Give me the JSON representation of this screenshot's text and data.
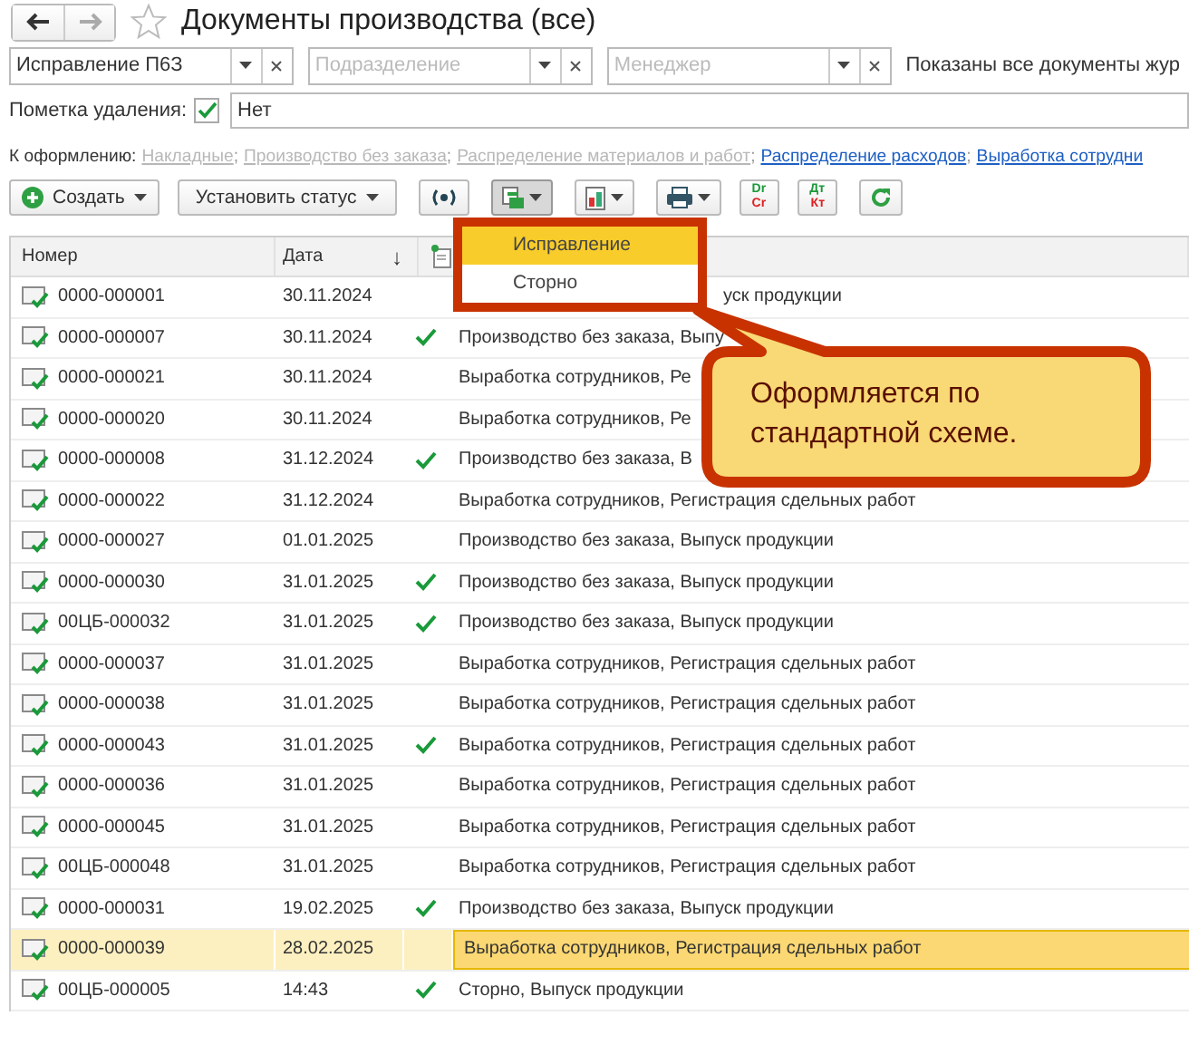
{
  "window": {
    "title": "Документы производства (все)",
    "favorite": false
  },
  "filters": [
    {
      "value": "Исправление П6З"
    },
    {
      "placeholder": "Подразделение"
    },
    {
      "placeholder": "Менеджер"
    }
  ],
  "filter_note": "Показаны все документы жур",
  "deletion_mark": {
    "label": "Пометка удаления:",
    "checked": true,
    "value": "Нет"
  },
  "to_process": {
    "label": "К оформлению:",
    "links": [
      {
        "text": "Накладные",
        "disabled": true,
        "separator": ";"
      },
      {
        "text": "Производство без заказа",
        "disabled": true,
        "separator": ";"
      },
      {
        "text": "Распределение материалов и работ",
        "disabled": true,
        "separator": ";"
      },
      {
        "text": "Распределение расходов",
        "disabled": false,
        "separator": ";"
      },
      {
        "text": "Выработка сотрудни",
        "disabled": false
      }
    ]
  },
  "toolbar": [
    {
      "kind": "create",
      "label": "Создать"
    },
    {
      "kind": "status",
      "label": "Установить статус"
    },
    {
      "kind": "exchange"
    },
    {
      "kind": "based",
      "pressed": true
    },
    {
      "kind": "report"
    },
    {
      "kind": "print"
    },
    {
      "kind": "drcr",
      "top": "Dr",
      "bottom": "Cr"
    },
    {
      "kind": "drcr",
      "top": "Дт",
      "bottom": "Кт"
    },
    {
      "kind": "refresh"
    }
  ],
  "table": {
    "columns": [
      {
        "label": "Номер"
      },
      {
        "label": "Дата",
        "sort": "↓"
      },
      {
        "kind": "icon"
      },
      {
        "kind": "blank"
      }
    ],
    "rows": [
      {
        "number": "0000-000001",
        "date": "30.11.2024",
        "mark": false,
        "description": "уск продукции",
        "covered": true,
        "selected": false
      },
      {
        "number": "0000-000007",
        "date": "30.11.2024",
        "mark": true,
        "description": "Производство без заказа, Выпу",
        "selected": false
      },
      {
        "number": "0000-000021",
        "date": "30.11.2024",
        "mark": false,
        "description": "Выработка сотрудников, Ре",
        "selected": false
      },
      {
        "number": "0000-000020",
        "date": "30.11.2024",
        "mark": false,
        "description": "Выработка сотрудников, Ре",
        "selected": false
      },
      {
        "number": "0000-000008",
        "date": "31.12.2024",
        "mark": true,
        "description": "Производство без заказа, В",
        "selected": false
      },
      {
        "number": "0000-000022",
        "date": "31.12.2024",
        "mark": false,
        "description": "Выработка сотрудников, Регистрация сдельных работ",
        "selected": false
      },
      {
        "number": "0000-000027",
        "date": "01.01.2025",
        "mark": false,
        "description": "Производство без заказа, Выпуск продукции",
        "selected": false
      },
      {
        "number": "0000-000030",
        "date": "31.01.2025",
        "mark": true,
        "description": "Производство без заказа, Выпуск продукции",
        "selected": false
      },
      {
        "number": "00ЦБ-000032",
        "date": "31.01.2025",
        "mark": true,
        "description": "Производство без заказа, Выпуск продукции",
        "selected": false
      },
      {
        "number": "0000-000037",
        "date": "31.01.2025",
        "mark": false,
        "description": "Выработка сотрудников, Регистрация сдельных работ",
        "selected": false
      },
      {
        "number": "0000-000038",
        "date": "31.01.2025",
        "mark": false,
        "description": "Выработка сотрудников, Регистрация сдельных работ",
        "selected": false
      },
      {
        "number": "0000-000043",
        "date": "31.01.2025",
        "mark": true,
        "description": "Выработка сотрудников, Регистрация сдельных работ",
        "selected": false
      },
      {
        "number": "0000-000036",
        "date": "31.01.2025",
        "mark": false,
        "description": "Выработка сотрудников, Регистрация сдельных работ",
        "selected": false
      },
      {
        "number": "0000-000045",
        "date": "31.01.2025",
        "mark": false,
        "description": "Выработка сотрудников, Регистрация сдельных работ",
        "selected": false
      },
      {
        "number": "00ЦБ-000048",
        "date": "31.01.2025",
        "mark": false,
        "description": "Выработка сотрудников, Регистрация сдельных работ",
        "selected": false
      },
      {
        "number": "0000-000031",
        "date": "19.02.2025",
        "mark": true,
        "description": "Производство без заказа, Выпуск продукции",
        "selected": false
      },
      {
        "number": "0000-000039",
        "date": "28.02.2025",
        "mark": false,
        "description": "Выработка сотрудников, Регистрация сдельных работ",
        "selected": true
      },
      {
        "number": "00ЦБ-000005",
        "date": "14:43",
        "mark": true,
        "description": "Сторно, Выпуск продукции",
        "selected": false
      }
    ]
  },
  "menu": [
    {
      "label": "Исправление",
      "selected": true
    },
    {
      "label": "Сторно",
      "selected": false
    }
  ],
  "callout": {
    "text": "Оформляется по стандартной схеме."
  }
}
